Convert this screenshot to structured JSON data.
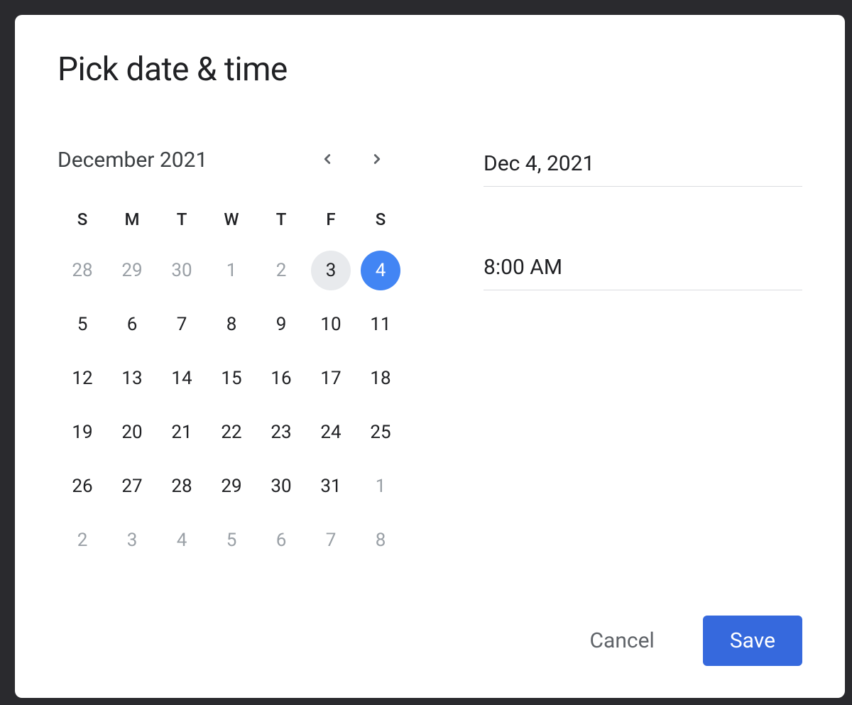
{
  "modal": {
    "title": "Pick date & time"
  },
  "calendar": {
    "month_label": "December 2021",
    "weekdays": [
      "S",
      "M",
      "T",
      "W",
      "T",
      "F",
      "S"
    ],
    "days": [
      {
        "n": "28",
        "state": "other"
      },
      {
        "n": "29",
        "state": "other"
      },
      {
        "n": "30",
        "state": "other"
      },
      {
        "n": "1",
        "state": "other"
      },
      {
        "n": "2",
        "state": "other"
      },
      {
        "n": "3",
        "state": "today"
      },
      {
        "n": "4",
        "state": "selected"
      },
      {
        "n": "5",
        "state": "current"
      },
      {
        "n": "6",
        "state": "current"
      },
      {
        "n": "7",
        "state": "current"
      },
      {
        "n": "8",
        "state": "current"
      },
      {
        "n": "9",
        "state": "current"
      },
      {
        "n": "10",
        "state": "current"
      },
      {
        "n": "11",
        "state": "current"
      },
      {
        "n": "12",
        "state": "current"
      },
      {
        "n": "13",
        "state": "current"
      },
      {
        "n": "14",
        "state": "current"
      },
      {
        "n": "15",
        "state": "current"
      },
      {
        "n": "16",
        "state": "current"
      },
      {
        "n": "17",
        "state": "current"
      },
      {
        "n": "18",
        "state": "current"
      },
      {
        "n": "19",
        "state": "current"
      },
      {
        "n": "20",
        "state": "current"
      },
      {
        "n": "21",
        "state": "current"
      },
      {
        "n": "22",
        "state": "current"
      },
      {
        "n": "23",
        "state": "current"
      },
      {
        "n": "24",
        "state": "current"
      },
      {
        "n": "25",
        "state": "current"
      },
      {
        "n": "26",
        "state": "current"
      },
      {
        "n": "27",
        "state": "current"
      },
      {
        "n": "28",
        "state": "current"
      },
      {
        "n": "29",
        "state": "current"
      },
      {
        "n": "30",
        "state": "current"
      },
      {
        "n": "31",
        "state": "current"
      },
      {
        "n": "1",
        "state": "other"
      },
      {
        "n": "2",
        "state": "other"
      },
      {
        "n": "3",
        "state": "other"
      },
      {
        "n": "4",
        "state": "other"
      },
      {
        "n": "5",
        "state": "other"
      },
      {
        "n": "6",
        "state": "other"
      },
      {
        "n": "7",
        "state": "other"
      },
      {
        "n": "8",
        "state": "other"
      }
    ]
  },
  "fields": {
    "date_value": "Dec 4, 2021",
    "time_value": "8:00 AM"
  },
  "actions": {
    "cancel_label": "Cancel",
    "save_label": "Save"
  },
  "colors": {
    "accent": "#4285f4",
    "save_button": "#3669dd",
    "today_bg": "#e8eaed",
    "text_primary": "#202124",
    "text_secondary": "#5f6368",
    "text_muted": "#9aa0a6"
  }
}
